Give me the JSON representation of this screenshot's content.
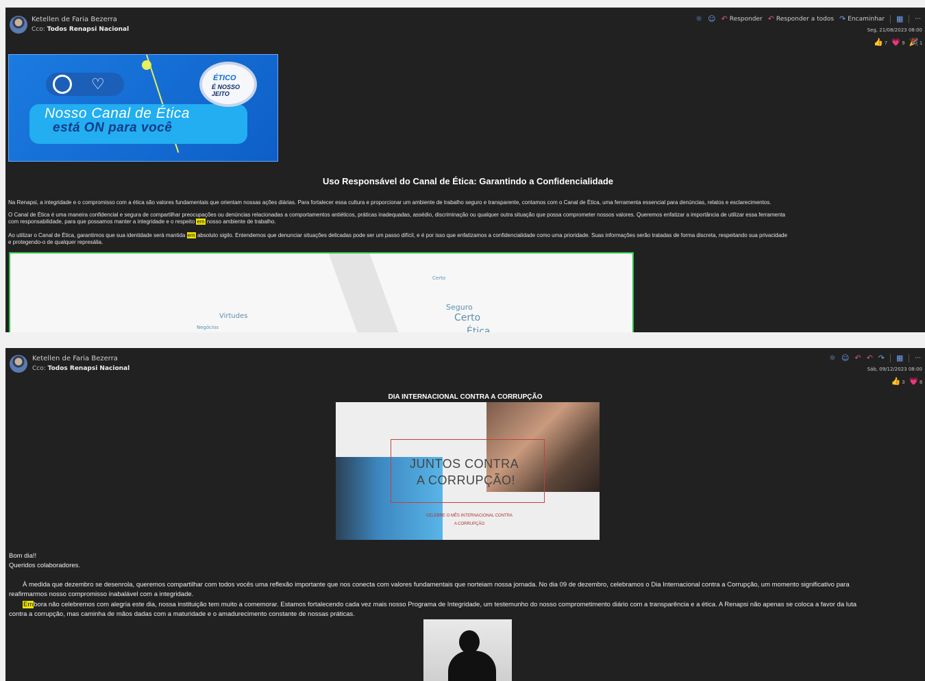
{
  "email1": {
    "sender": "Ketellen de Faria Bezerra",
    "cco_label": "Cco:",
    "cco_value": "Todos Renapsi Nacional",
    "toolbar": {
      "reply": "Responder",
      "reply_all": "Responder a todos",
      "forward": "Encaminhar"
    },
    "date": "Seg, 21/08/2023 08:00",
    "reactions": {
      "like": "7",
      "heart": "9",
      "celebrate": "1"
    },
    "banner": {
      "line1": "Nosso Canal de Ética",
      "line2": "está ON para você",
      "seal1": "ÉTICO",
      "seal2": "É NOSSO JEITO"
    },
    "title": "Uso Responsável do Canal de Ética: Garantindo a Confidencialidade",
    "p1": "Na Renapsi, a integridade e o compromisso com a ética são valores fundamentais que orientam nossas ações diárias. Para fortalecer essa cultura e proporcionar um ambiente de trabalho seguro e transparente, contamos com o Canal de Ética, uma ferramenta essencial para denúncias, relatos e esclarecimentos.",
    "p2a": "O Canal de Ética é uma maneira confidencial e segura de compartilhar preocupações ou denúncias relacionadas a comportamentos antiéticos, práticas inadequadas, assédio, discriminação ou qualquer outra situação que possa comprometer nossos valores. Queremos enfatizar a importância de utilizar essa ferramenta",
    "p2b_pre": "com responsabilidade, para que possamos manter a integridade e o respeito",
    "p2b_mark": "em",
    "p2b_post": "nosso ambiente de trabalho.",
    "p3a_pre": "Ao utilizar o Canal de Ética, garantimos que sua identidade será mantida",
    "p3a_mark": "em",
    "p3a_post": "absoluto sigilo. Entendemos que denunciar situações delicadas pode ser um passo difícil, e é por isso que enfatizamos a confidencialidade como uma prioridade. Suas informações serão tratadas de forma discreta, respeitando sua privacidade",
    "p3b": "e protegendo-o de qualquer represália.",
    "cloud_words": [
      "Virtudes",
      "Negócios",
      "Certo",
      "Seguro",
      "Certo",
      "Ética"
    ]
  },
  "email2": {
    "sender": "Ketellen de Faria Bezerra",
    "cco_label": "Cco:",
    "cco_value": "Todos Renapsi Nacional",
    "date": "Sáb, 09/12/2023 08:00",
    "reactions": {
      "like": "3",
      "heart": "8"
    },
    "title": "DIA INTERNACIONAL CONTRA A CORRUPÇÃO",
    "poster": {
      "line1": "JUNTOS CONTRA",
      "line2": "A CORRUPÇÃO!",
      "sub1": "CELEBRE O MÊS INTERNACIONAL CONTRA",
      "sub2": "A CORRUPÇÃO"
    },
    "greeting": "Bom dia!!",
    "salutation": "Queridos colaboradores.",
    "p1a": "À medida que dezembro se desenrola, queremos compartilhar com todos vocês uma reflexão importante que nos conecta com valores fundamentais que norteiam nossa jornada. No dia 09 de dezembro, celebramos o Dia Internacional contra a Corrupção, um momento significativo para",
    "p1b": "reafirmarmos nosso compromisso inabalável com a integridade.",
    "p2a_mark": "Em",
    "p2a_post": "bora não celebremos com alegria este dia, nossa instituição tem muito a comemorar. Estamos fortalecendo cada vez mais nosso Programa de Integridade, um testemunho do nosso comprometimento diário com a transparência e a ética. A Renapsi não apenas se coloca a favor da luta",
    "p2b": "contra a corrupção, mas caminha de mãos dadas com a maturidade e o amadurecimento constante de nossas práticas."
  },
  "colors": {
    "pane_bg": "#212121",
    "accent": "#6ea1f0",
    "highlight": "#f2e600",
    "frame_green": "#33c24a"
  }
}
